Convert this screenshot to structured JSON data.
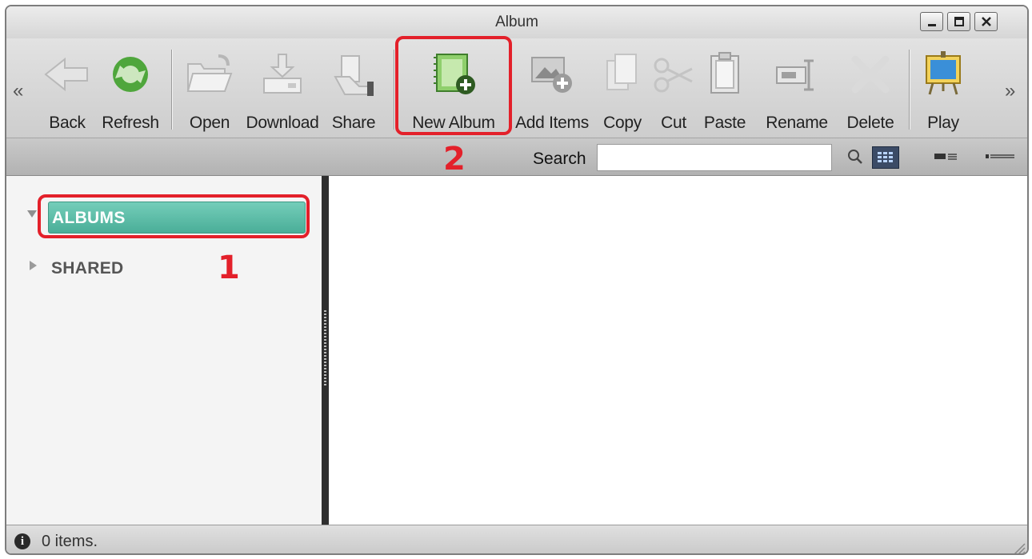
{
  "window": {
    "title": "Album",
    "controls": [
      "minimize-icon",
      "maximize-icon",
      "close-icon"
    ]
  },
  "toolbar": {
    "scroll_left": "«",
    "scroll_right": "»",
    "buttons": [
      {
        "id": "back",
        "label": "Back",
        "icon": "back-arrow-icon",
        "enabled": false
      },
      {
        "id": "refresh",
        "label": "Refresh",
        "icon": "refresh-icon",
        "enabled": true
      },
      {
        "id": "open",
        "label": "Open",
        "icon": "open-folder-icon",
        "enabled": false
      },
      {
        "id": "download",
        "label": "Download",
        "icon": "download-icon",
        "enabled": false
      },
      {
        "id": "share",
        "label": "Share",
        "icon": "share-icon",
        "enabled": false
      },
      {
        "id": "new_album",
        "label": "New Album",
        "icon": "new-album-icon",
        "enabled": true
      },
      {
        "id": "add_items",
        "label": "Add Items",
        "icon": "add-items-icon",
        "enabled": false
      },
      {
        "id": "copy",
        "label": "Copy",
        "icon": "copy-icon",
        "enabled": false
      },
      {
        "id": "cut",
        "label": "Cut",
        "icon": "scissors-icon",
        "enabled": false
      },
      {
        "id": "paste",
        "label": "Paste",
        "icon": "clipboard-icon",
        "enabled": false
      },
      {
        "id": "rename",
        "label": "Rename",
        "icon": "rename-icon",
        "enabled": false
      },
      {
        "id": "delete",
        "label": "Delete",
        "icon": "delete-x-icon",
        "enabled": false
      },
      {
        "id": "play",
        "label": "Play",
        "icon": "slideshow-icon",
        "enabled": true
      }
    ]
  },
  "search": {
    "label": "Search",
    "value": "",
    "views": [
      "grid-view-icon",
      "list-view-icon",
      "detail-view-icon"
    ],
    "active_view": "grid-view-icon"
  },
  "sidebar": {
    "nodes": [
      {
        "label": "ALBUMS",
        "expanded": true,
        "selected": true
      },
      {
        "label": "SHARED",
        "expanded": false,
        "selected": false
      }
    ]
  },
  "status": {
    "text": "0 items.",
    "icon": "info-icon",
    "info_glyph": "i"
  },
  "annotations": {
    "step1": "1",
    "step2": "2",
    "color": "#e3202a"
  },
  "colors": {
    "selection": "#5bbca6",
    "splitter": "#2f2f2f"
  }
}
